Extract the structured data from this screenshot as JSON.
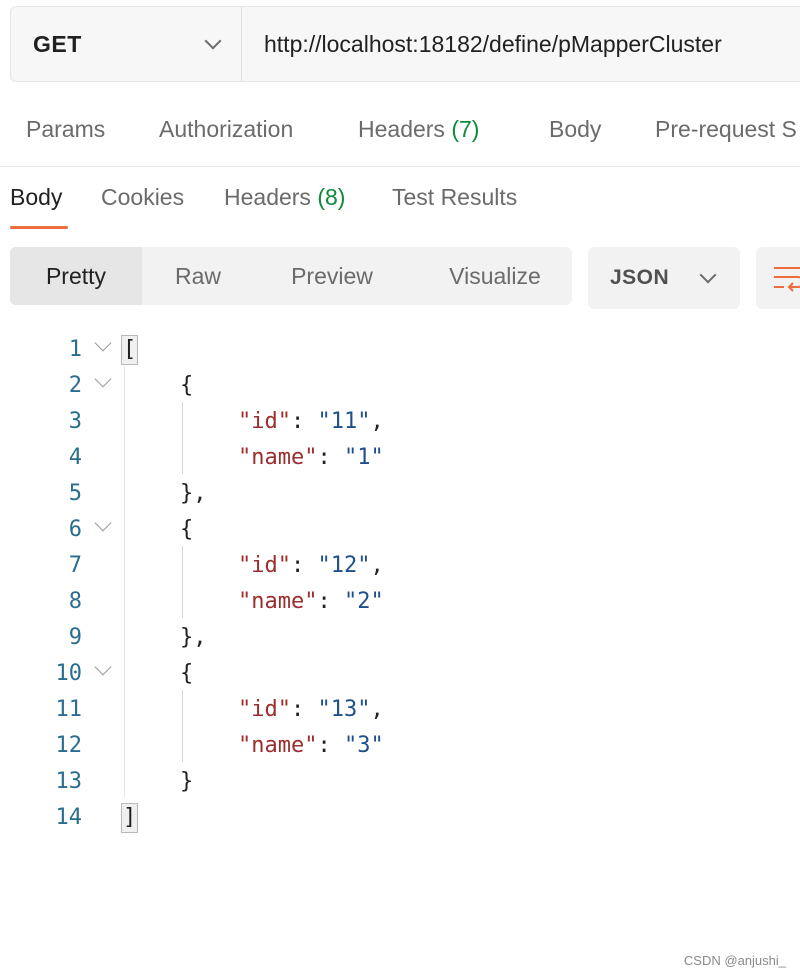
{
  "request": {
    "method": "GET",
    "url": "http://localhost:18182/define/pMapperCluster"
  },
  "request_tabs": [
    {
      "label": "Params"
    },
    {
      "label": "Authorization"
    },
    {
      "label": "Headers",
      "count": "(7)"
    },
    {
      "label": "Body"
    },
    {
      "label": "Pre-request S"
    }
  ],
  "response_tabs": [
    {
      "label": "Body"
    },
    {
      "label": "Cookies"
    },
    {
      "label": "Headers",
      "count": "(8)"
    },
    {
      "label": "Test Results"
    }
  ],
  "view_modes": [
    "Pretty",
    "Raw",
    "Preview",
    "Visualize"
  ],
  "format": "JSON",
  "code_lines": [
    [
      "1",
      "["
    ],
    [
      "2",
      "{"
    ],
    [
      "3",
      "\"id\": \"11\","
    ],
    [
      "4",
      "\"name\": \"1\""
    ],
    [
      "5",
      "},"
    ],
    [
      "6",
      "{"
    ],
    [
      "7",
      "\"id\": \"12\","
    ],
    [
      "8",
      "\"name\": \"2\""
    ],
    [
      "9",
      "},"
    ],
    [
      "10",
      "{"
    ],
    [
      "11",
      "\"id\": \"13\","
    ],
    [
      "12",
      "\"name\": \"3\""
    ],
    [
      "13",
      "}"
    ],
    [
      "14",
      "]"
    ]
  ],
  "watermark": "CSDN @anjushi_",
  "colors": {
    "accent": "#ef6c3c",
    "count_green": "#0e8a3b",
    "json_key": "#9c2d2d",
    "json_value": "#1f4f8a",
    "line_number": "#2b6d8f"
  }
}
